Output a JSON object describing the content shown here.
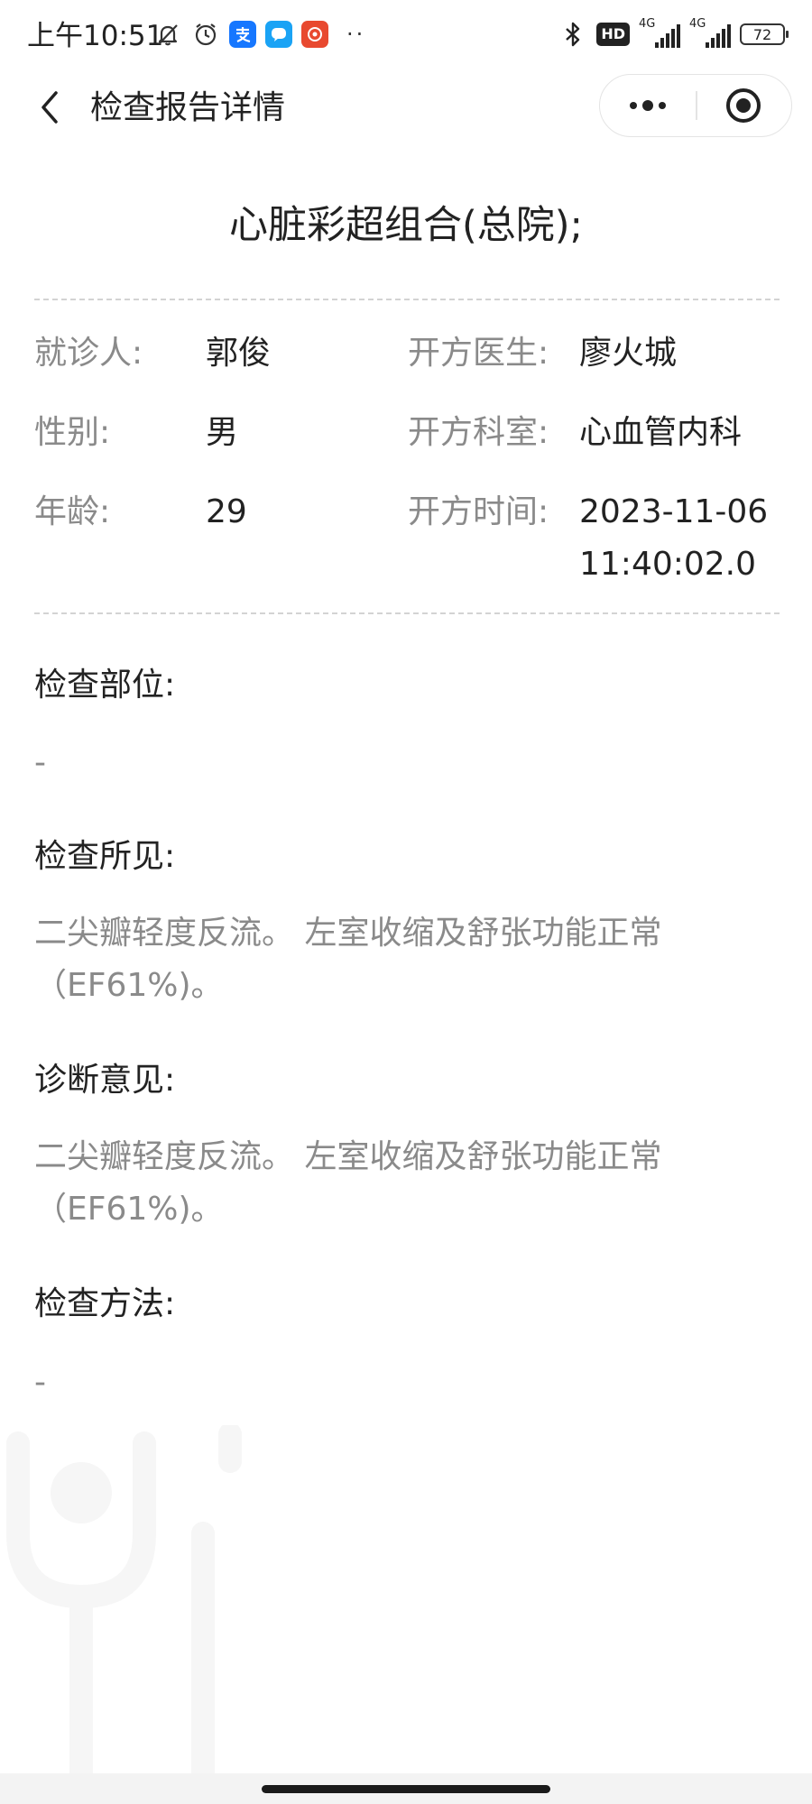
{
  "status_bar": {
    "time": "上午10:51",
    "network_badge": "HD",
    "signal1_label": "4G",
    "signal2_label": "4G",
    "battery_level": "72",
    "more_dots": "··"
  },
  "nav": {
    "title": "检查报告详情"
  },
  "report": {
    "title": "心脏彩超组合(总院);",
    "patient_label": "就诊人:",
    "patient_value": "郭俊",
    "gender_label": "性别:",
    "gender_value": "男",
    "age_label": "年龄:",
    "age_value": "29",
    "doctor_label": "开方医生:",
    "doctor_value": "廖火城",
    "department_label": "开方科室:",
    "department_value": "心血管内科",
    "time_label": "开方时间:",
    "time_value_date": "2023-11-06",
    "time_value_time": "11:40:02.0"
  },
  "sections": [
    {
      "heading": "检查部位:",
      "content": "-"
    },
    {
      "heading": "检查所见:",
      "content": "二尖瓣轻度反流。 左室收缩及舒张功能正常（EF61%)。"
    },
    {
      "heading": "诊断意见:",
      "content": "二尖瓣轻度反流。 左室收缩及舒张功能正常（EF61%)。"
    },
    {
      "heading": "检查方法:",
      "content": "-"
    }
  ]
}
